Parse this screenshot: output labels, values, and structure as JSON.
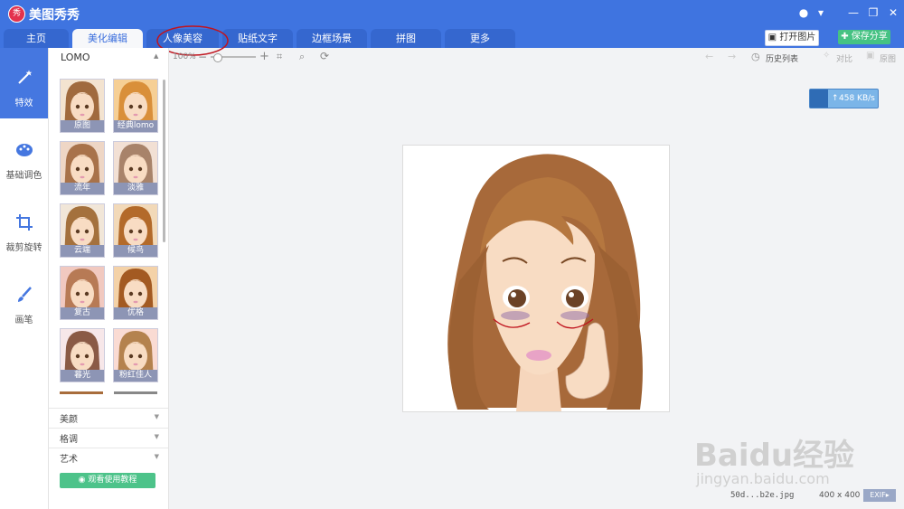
{
  "app": {
    "title": "美图秀秀",
    "logo_text": "秀"
  },
  "tabs": [
    {
      "label": "主页"
    },
    {
      "label": "美化编辑"
    },
    {
      "label": "人像美容"
    },
    {
      "label": "贴纸文字"
    },
    {
      "label": "边框场景"
    },
    {
      "label": "拼图"
    },
    {
      "label": "更多"
    }
  ],
  "active_tab": "美化编辑",
  "actions": {
    "open": "打开图片",
    "save": "保存分享"
  },
  "rail": [
    {
      "label": "特效",
      "icon": "magic-wand-icon",
      "active": true
    },
    {
      "label": "基础调色",
      "icon": "palette-icon"
    },
    {
      "label": "裁剪旋转",
      "icon": "crop-icon"
    },
    {
      "label": "画笔",
      "icon": "brush-icon"
    }
  ],
  "panel": {
    "title": "LOMO",
    "effects": [
      "原图",
      "经典lomo",
      "流年",
      "淡雅",
      "云端",
      "候鸟",
      "复古",
      "优格",
      "暮光",
      "粉红佳人"
    ],
    "sections": [
      "美颜",
      "格调",
      "艺术"
    ],
    "tutorial": "观看使用教程"
  },
  "toolbar": {
    "zoom": "100%",
    "history": "历史列表",
    "compare": "对比",
    "original": "原图"
  },
  "speed": "458 KB/s",
  "file": {
    "name": "50d...b2e.jpg",
    "dims": "400 x 400",
    "exif": "EXIF"
  },
  "watermark": {
    "logo": "Baidu经验",
    "url": "jingyan.baidu.com"
  },
  "colors": {
    "accent": "#3f74e0",
    "save": "#46c283",
    "annotation": "#c0141e"
  }
}
